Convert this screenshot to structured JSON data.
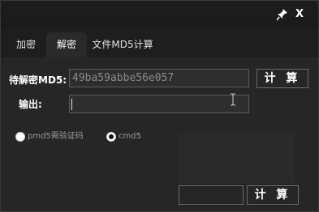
{
  "window": {
    "pin_icon": "pin-icon",
    "close_label": "X"
  },
  "tabs": [
    {
      "label": "加密"
    },
    {
      "label": "解密"
    },
    {
      "label": "文件MD5计算"
    }
  ],
  "decrypt": {
    "md5_label": "待解密MD5:",
    "md5_value": "49ba59abbe56e057",
    "output_label": "输出:",
    "output_value": "",
    "compute_label": "计 算"
  },
  "options": [
    {
      "label": "pmd5需验证码",
      "checked": false
    },
    {
      "label": "cmd5",
      "checked": true
    }
  ],
  "file": {
    "path_value": "",
    "compute_label": "计 算"
  }
}
